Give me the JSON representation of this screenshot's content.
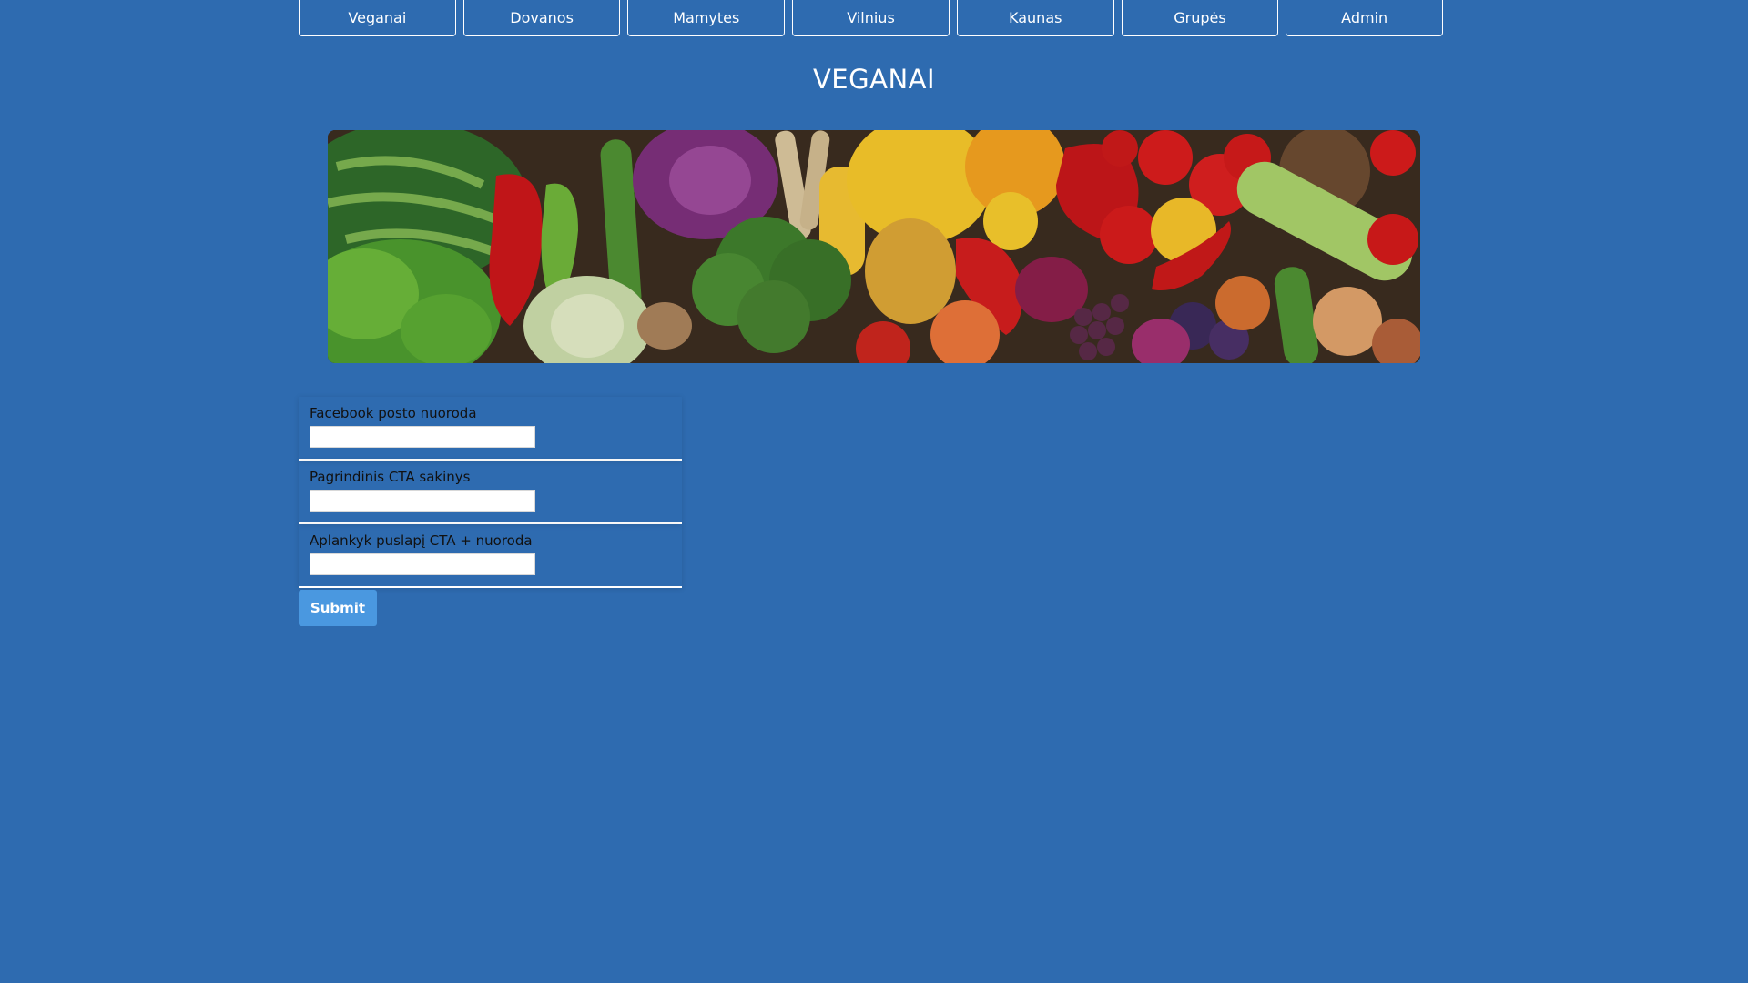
{
  "nav": {
    "items": [
      {
        "label": "Veganai"
      },
      {
        "label": "Dovanos"
      },
      {
        "label": "Mamytes"
      },
      {
        "label": "Vilnius"
      },
      {
        "label": "Kaunas"
      },
      {
        "label": "Grupės"
      },
      {
        "label": "Admin"
      }
    ]
  },
  "page": {
    "title": "VEGANAI",
    "banner_icon": "vegetables-banner-image"
  },
  "form": {
    "fields": [
      {
        "label": "Facebook posto nuoroda",
        "value": "",
        "placeholder": ""
      },
      {
        "label": "Pagrindinis CTA sakinys",
        "value": "",
        "placeholder": ""
      },
      {
        "label": "Aplankyk puslapį CTA + nuoroda",
        "value": "",
        "placeholder": ""
      }
    ],
    "submit_label": "Submit"
  },
  "colors": {
    "background": "#2e6bb0",
    "submit": "#4a98e0",
    "nav_border": "#ffffff"
  }
}
